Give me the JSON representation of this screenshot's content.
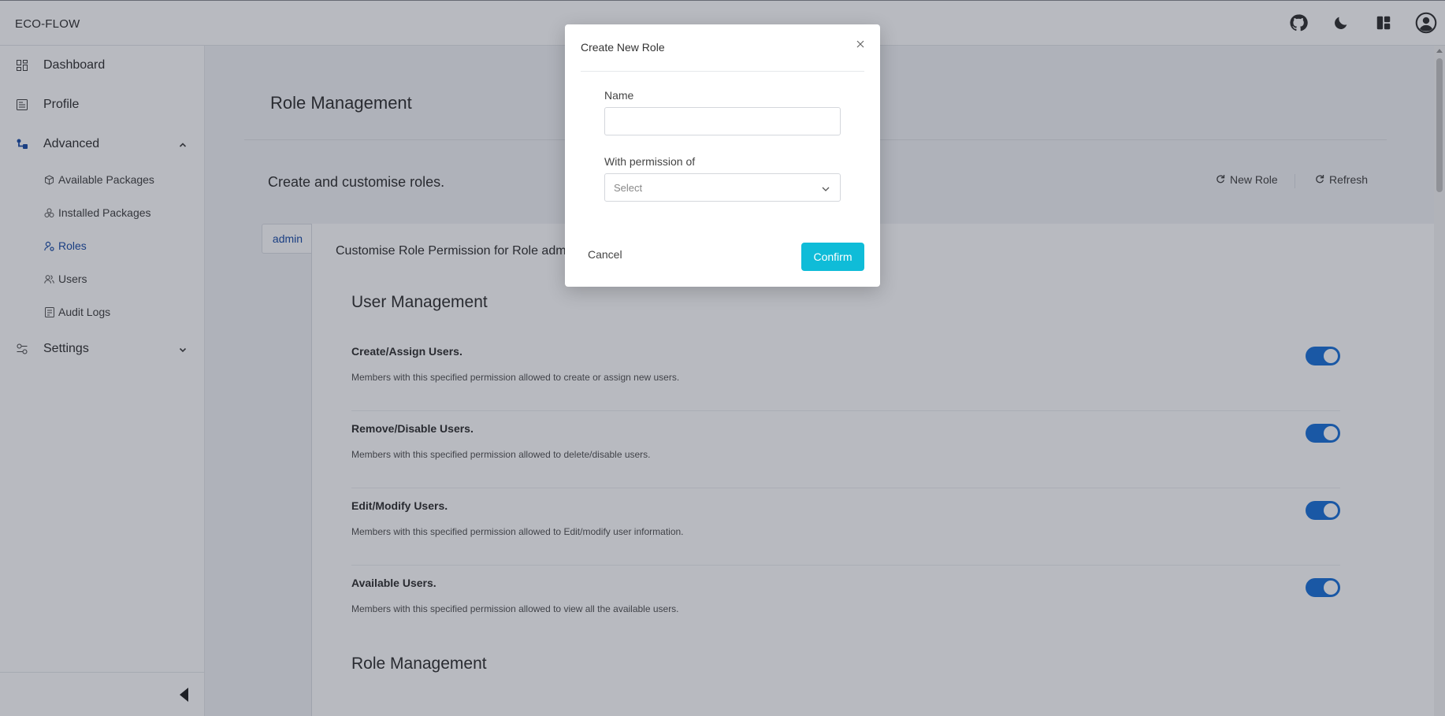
{
  "app": {
    "title": "ECO-FLOW"
  },
  "header": {
    "icons": [
      "github-icon",
      "dark-mode-icon",
      "layout-icon",
      "account-icon"
    ]
  },
  "sidebar": {
    "items": [
      {
        "label": "Dashboard",
        "icon": "dashboard-icon"
      },
      {
        "label": "Profile",
        "icon": "profile-icon"
      },
      {
        "label": "Advanced",
        "icon": "advanced-icon",
        "expanded": true
      },
      {
        "label": "Settings",
        "icon": "settings-icon",
        "expanded": false
      }
    ],
    "advanced_children": [
      {
        "label": "Available Packages",
        "icon": "package-icon"
      },
      {
        "label": "Installed Packages",
        "icon": "packages-icon"
      },
      {
        "label": "Roles",
        "icon": "roles-icon",
        "active": true
      },
      {
        "label": "Users",
        "icon": "users-icon"
      },
      {
        "label": "Audit Logs",
        "icon": "audit-log-icon"
      }
    ]
  },
  "main": {
    "page_title": "Role Management",
    "subtitle": "Create and customise roles.",
    "actions": {
      "new_role": "New Role",
      "refresh": "Refresh"
    },
    "tabs": [
      {
        "label": "admin"
      }
    ],
    "panel_title": "Customise Role Permission for Role admin",
    "groups": [
      {
        "title": "User Management",
        "permissions": [
          {
            "title": "Create/Assign Users.",
            "description": "Members with this specified permission allowed to create or assign new users.",
            "enabled": true
          },
          {
            "title": "Remove/Disable Users.",
            "description": "Members with this specified permission allowed to delete/disable users.",
            "enabled": true
          },
          {
            "title": "Edit/Modify Users.",
            "description": "Members with this specified permission allowed to Edit/modify user information.",
            "enabled": true
          },
          {
            "title": "Available Users.",
            "description": "Members with this specified permission allowed to view all the available users.",
            "enabled": true
          }
        ]
      },
      {
        "title": "Role Management",
        "permissions": []
      }
    ]
  },
  "modal": {
    "title": "Create New Role",
    "name_label": "Name",
    "name_value": "",
    "permission_label": "With permission of",
    "permission_placeholder": "Select",
    "cancel_label": "Cancel",
    "confirm_label": "Confirm"
  },
  "colors": {
    "accent": "#1e4fa8",
    "toggle_on": "#1e73d8",
    "confirm": "#0fbcd8",
    "overlay": "rgba(20, 28, 48, 0.30)"
  }
}
